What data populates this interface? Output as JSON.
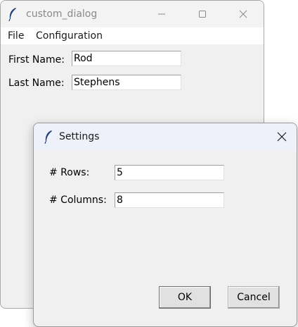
{
  "main_window": {
    "title": "custom_dialog",
    "menu": [
      "File",
      "Configuration"
    ],
    "fields": [
      {
        "label": "First Name:",
        "value": "Rod"
      },
      {
        "label": "Last Name:",
        "value": "Stephens"
      }
    ]
  },
  "dialog": {
    "title": "Settings",
    "fields": [
      {
        "label": "# Rows:",
        "value": "5"
      },
      {
        "label": "# Columns:",
        "value": "8"
      }
    ],
    "buttons": {
      "ok": "OK",
      "cancel": "Cancel"
    }
  },
  "icons": {
    "app": "feather-icon",
    "minimize": "minimize-icon",
    "maximize": "maximize-icon",
    "close": "close-icon"
  },
  "colors": {
    "titlebar_inactive": "#f3f3f3",
    "titlebar_active": "#eef1f9",
    "window_bg": "#f0f0f0",
    "feather": "#1f3f78"
  }
}
